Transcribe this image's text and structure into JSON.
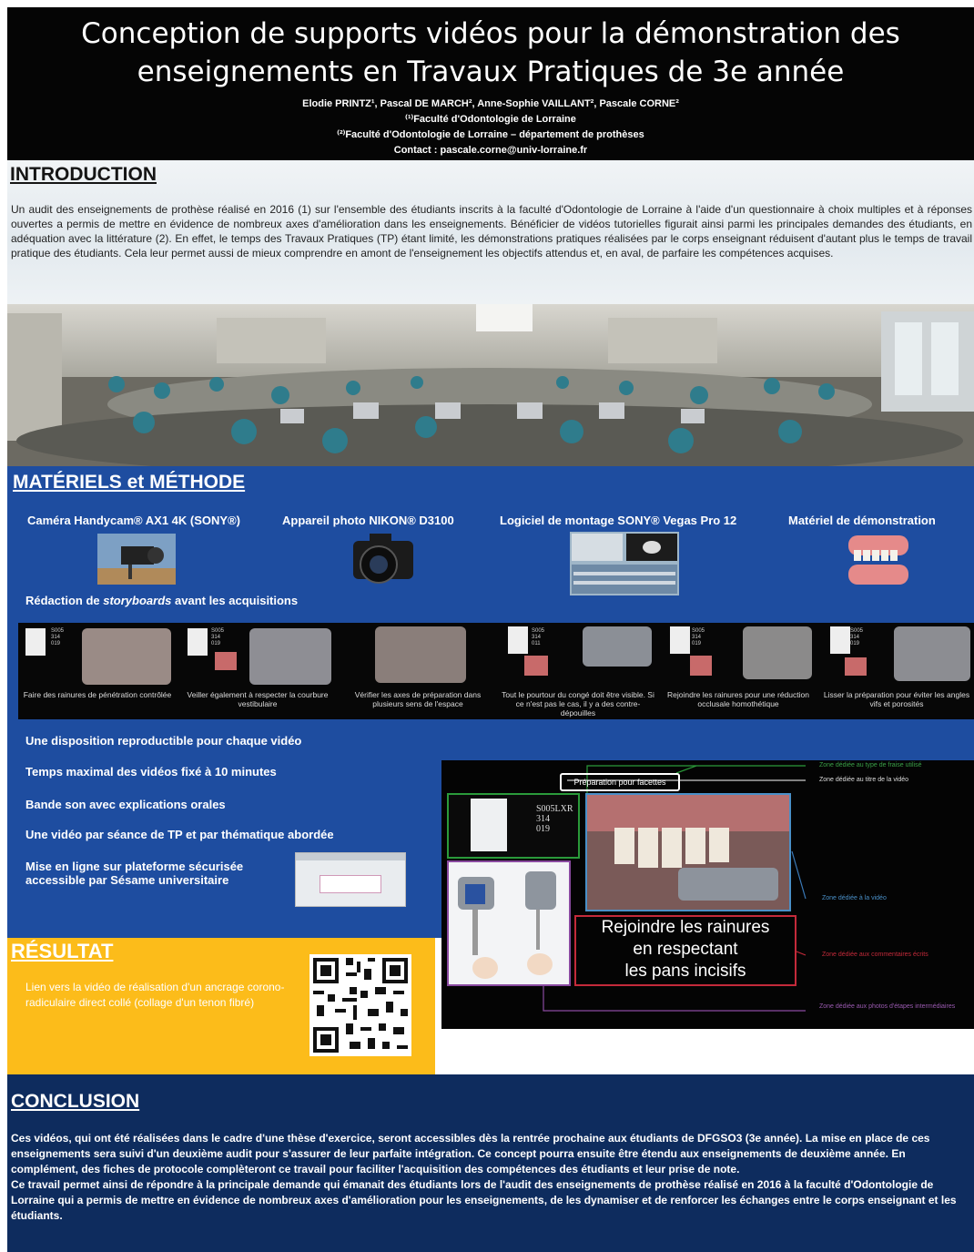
{
  "header": {
    "title": "Conception de supports vidéos pour la démonstration des enseignements en Travaux Pratiques de 3e année",
    "authors": "Elodie PRINTZ¹, Pascal DE MARCH², Anne-Sophie VAILLANT², Pascale CORNE²",
    "affiliation1": "⁽¹⁾Faculté d'Odontologie de Lorraine",
    "affiliation2": "⁽²⁾Faculté d'Odontologie de Lorraine – département de prothèses",
    "contact": "Contact : pascale.corne@univ-lorraine.fr"
  },
  "introduction": {
    "title": "INTRODUCTION",
    "text": "Un audit des enseignements de prothèse réalisé en 2016 (1) sur l'ensemble des étudiants inscrits à la faculté d'Odontologie de Lorraine à l'aide d'un questionnaire à choix multiples et à réponses ouvertes a permis de mettre en évidence de nombreux axes d'amélioration dans les enseignements. Bénéficier de vidéos tutorielles figurait ainsi parmi les principales demandes des étudiants, en adéquation avec la littérature (2). En effet, le temps des Travaux Pratiques (TP) étant limité, les démonstrations pratiques réalisées par le corps enseignant réduisent d'autant plus le temps de travail pratique des étudiants. Cela leur permet aussi de mieux comprendre en amont de l'enseignement les objectifs attendus et, en aval, de parfaire les compétences acquises."
  },
  "methods": {
    "title": "MATÉRIELS et MÉTHODE",
    "equipment": [
      "Caméra Handycam® AX1 4K (SONY®)",
      "Appareil photo NIKON® D3100",
      "Logiciel de montage SONY® Vegas Pro 12",
      "Matériel de démonstration"
    ],
    "storyboard_prefix": "Rédaction de ",
    "storyboard_em": "storyboards",
    "storyboard_suffix": " avant les acquisitions",
    "storyboard_frames": [
      "Faire des rainures de pénétration contrôlée",
      "Veiller également à respecter la courbure vestibulaire",
      "Vérifier les axes de préparation dans plusieurs sens de l'espace",
      "Tout le pourtour du congé doit être visible. Si ce n'est pas le cas, il y a des contre-dépouilles",
      "Rejoindre les rainures pour une réduction occlusale homothétique",
      "Lisser la préparation pour éviter les angles vifs et porosités"
    ],
    "frame_codes": [
      "S005\n314\n019",
      "S005\n314\n019",
      "",
      "S005\n314\n011",
      "S005\n314\n019",
      "S005\n314\n019"
    ],
    "bullets": [
      "Une disposition reproductible pour chaque vidéo",
      "Temps maximal des vidéos fixé à 10 minutes",
      "Bande son avec explications orales",
      "Une vidéo par séance de TP et par thématique abordée",
      "Mise en ligne sur plateforme sécurisée accessible par Sésame universitaire"
    ],
    "template": {
      "header_box": "Préparation pour facettes",
      "code": "S005LXR\n314\n019",
      "caption": "Rejoindre les rainures\nen respectant\nles pans incisifs",
      "zones": [
        "Zone dédiée au type de fraise utilisé",
        "Zone dédiée au titre de la vidéo",
        "Zone dédiée à la vidéo",
        "Zone dédiée aux commentaires écrits",
        "Zone dédiée aux photos d'étapes intermédiaires"
      ]
    }
  },
  "result": {
    "title": "RÉSULTAT",
    "text": "Lien vers la vidéo de réalisation d'un ancrage corono-radiculaire direct collé (collage d'un tenon fibré)"
  },
  "conclusion": {
    "title": "CONCLUSION",
    "text": "Ces vidéos, qui ont été réalisées dans le cadre d'une thèse d'exercice, seront accessibles dès la rentrée prochaine aux étudiants de DFGSO3 (3e année). La mise en place de ces enseignements sera suivi d'un deuxième audit pour s'assurer de leur parfaite intégration. Ce concept pourra ensuite être étendu aux enseignements de deuxième année. En complément, des fiches de protocole complèteront ce travail pour faciliter l'acquisition des compétences des étudiants et leur prise de note.\nCe travail permet ainsi de répondre à la principale demande qui émanait des étudiants lors de l'audit des enseignements de prothèse réalisé en 2016 à la faculté d'Odontologie de Lorraine qui a permis de mettre en évidence de nombreux axes d'amélioration pour les enseignements, de les dynamiser et de renforcer les échanges entre le corps enseignant et les étudiants."
  },
  "colors": {
    "header_bg": "#050505",
    "methods_bg": "#1e4da0",
    "result_bg": "#fcbc1a",
    "conclusion_bg": "#0e2c5e"
  }
}
